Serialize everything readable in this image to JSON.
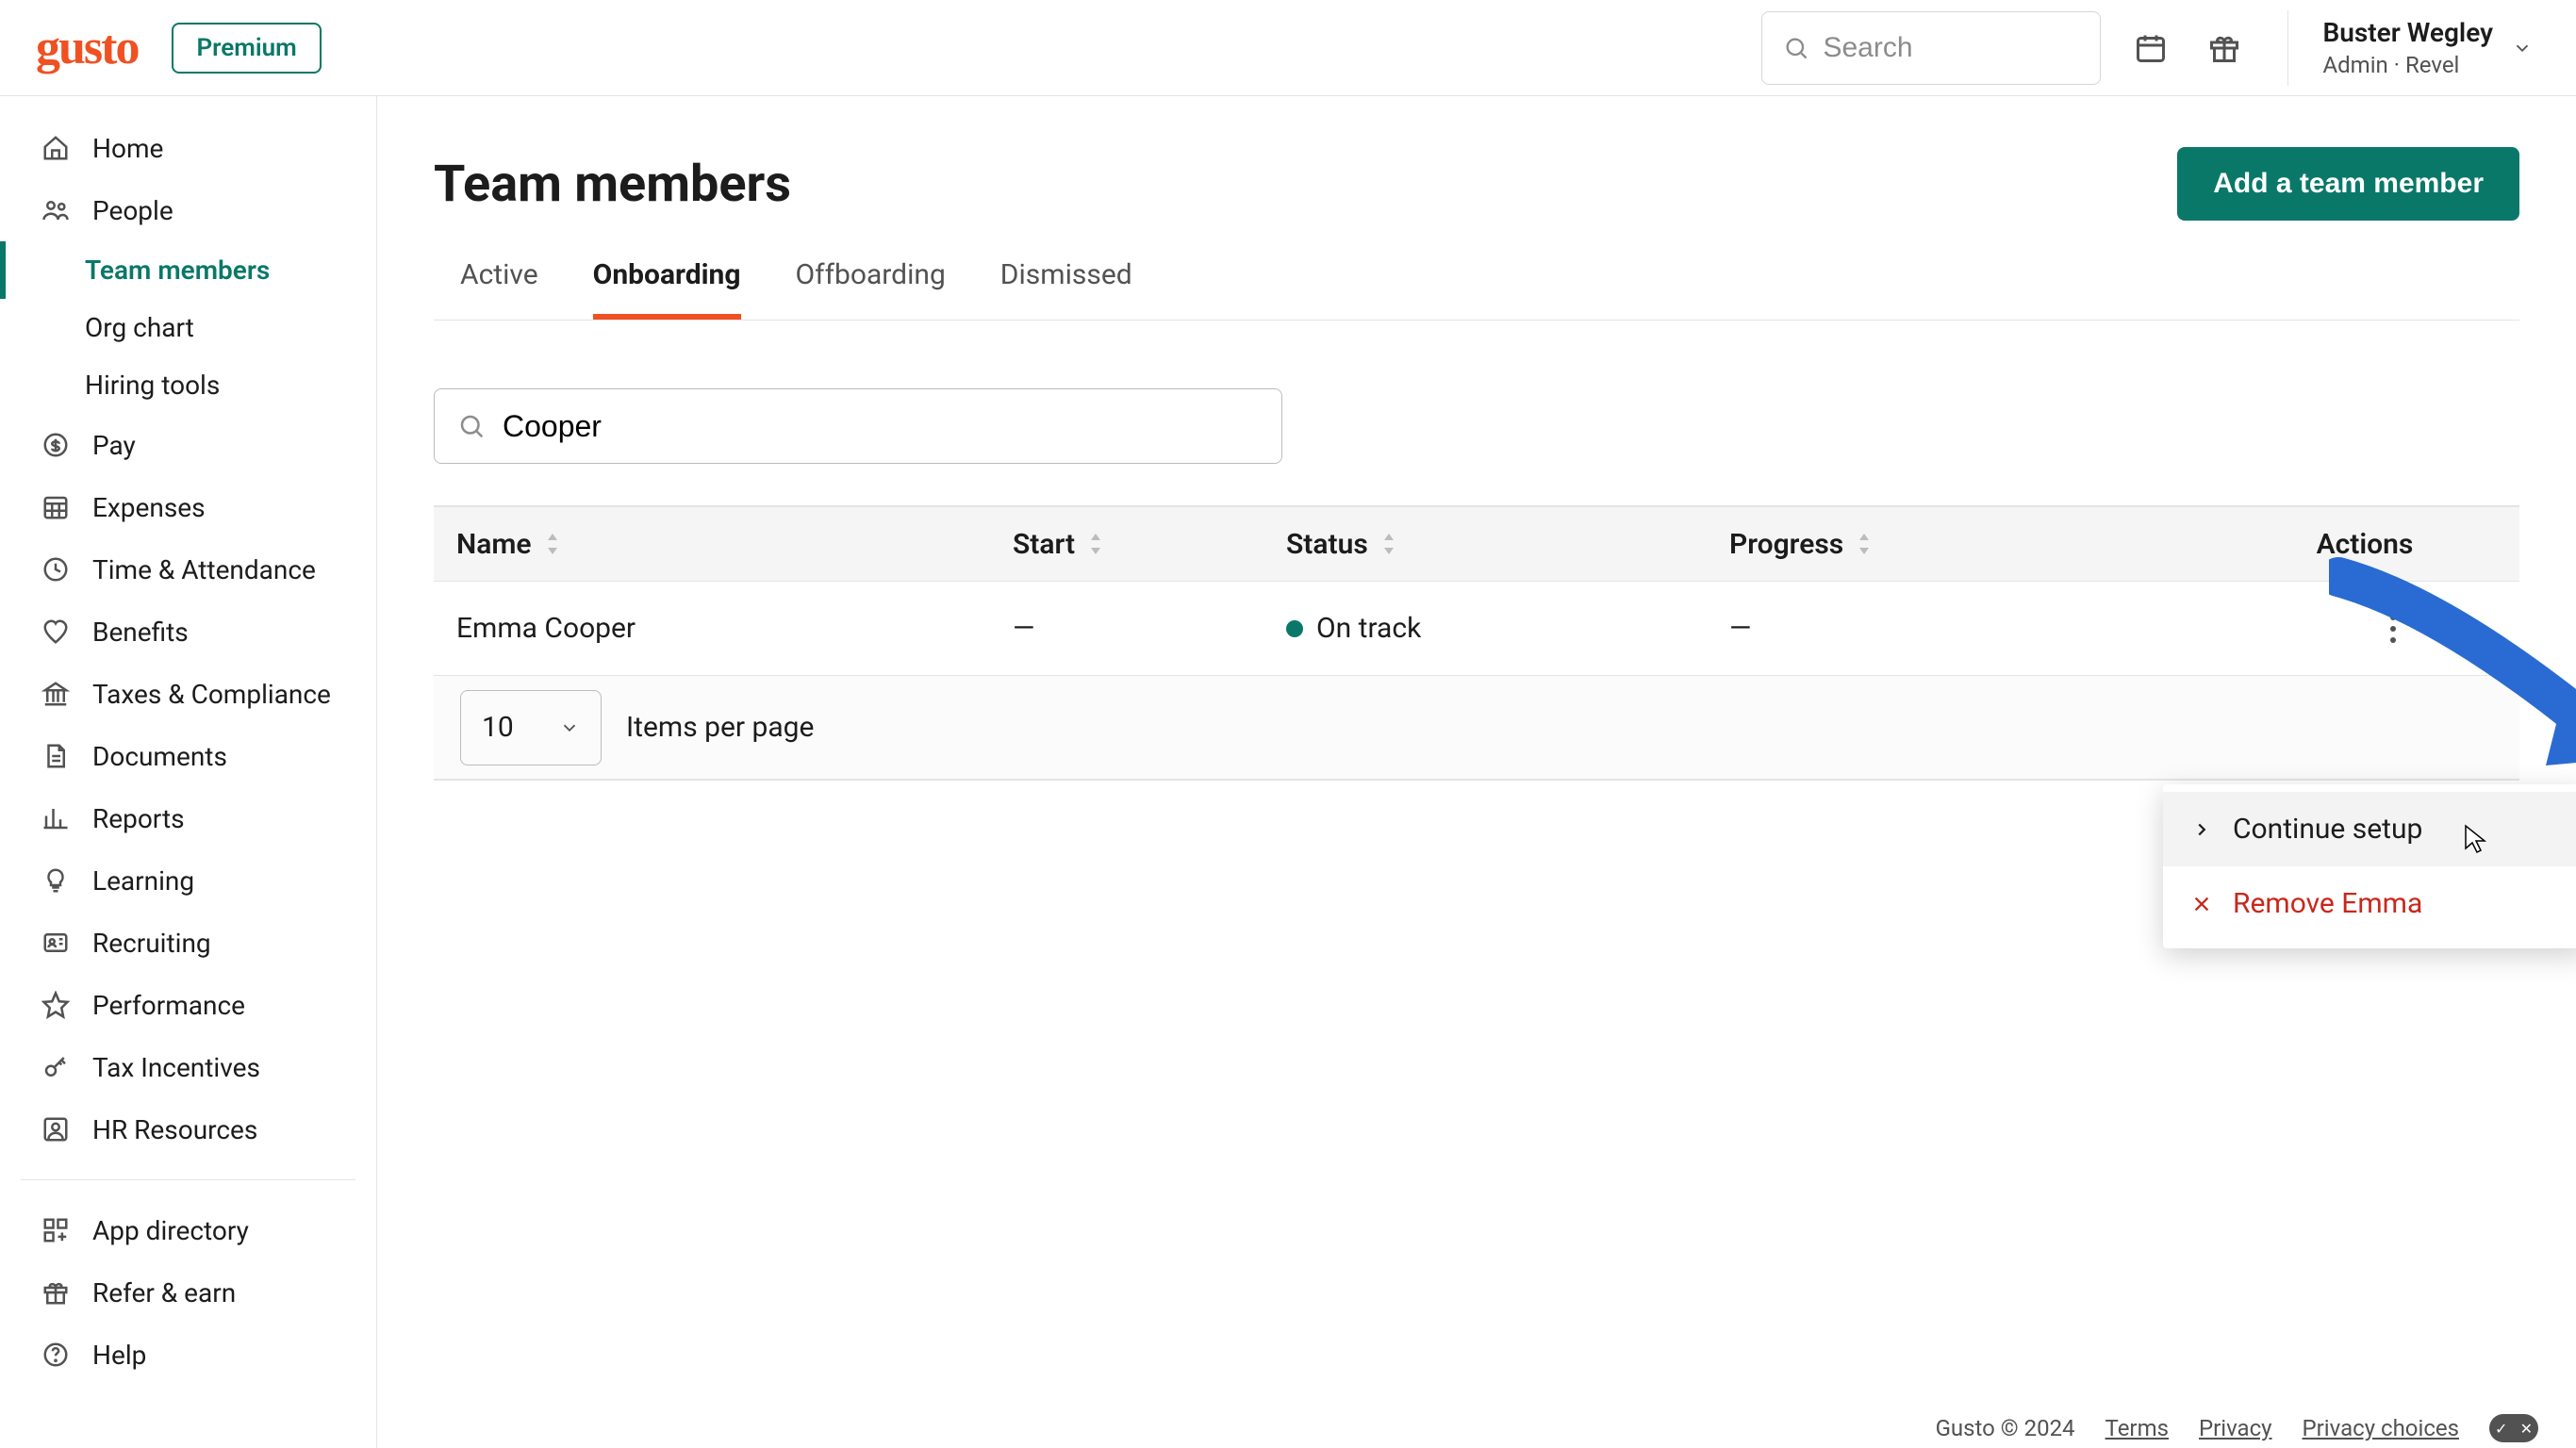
{
  "header": {
    "logo": "gusto",
    "premium_label": "Premium",
    "search_placeholder": "Search",
    "user_name": "Buster Wegley",
    "user_role": "Admin",
    "user_company": "Revel"
  },
  "sidebar": {
    "items": [
      {
        "label": "Home",
        "icon": "home-icon"
      },
      {
        "label": "People",
        "icon": "people-icon"
      },
      {
        "label": "Pay",
        "icon": "dollar-circle-icon"
      },
      {
        "label": "Expenses",
        "icon": "calendar-grid-icon"
      },
      {
        "label": "Time & Attendance",
        "icon": "clock-icon"
      },
      {
        "label": "Benefits",
        "icon": "heart-icon"
      },
      {
        "label": "Taxes & Compliance",
        "icon": "bank-icon"
      },
      {
        "label": "Documents",
        "icon": "doc-icon"
      },
      {
        "label": "Reports",
        "icon": "chart-icon"
      },
      {
        "label": "Learning",
        "icon": "lightbulb-icon"
      },
      {
        "label": "Recruiting",
        "icon": "id-icon"
      },
      {
        "label": "Performance",
        "icon": "star-icon"
      },
      {
        "label": "Tax Incentives",
        "icon": "key-icon"
      },
      {
        "label": "HR Resources",
        "icon": "user-square-icon"
      }
    ],
    "people_sub": [
      {
        "label": "Team members",
        "active": true
      },
      {
        "label": "Org chart",
        "active": false
      },
      {
        "label": "Hiring tools",
        "active": false
      }
    ],
    "secondary": [
      {
        "label": "App directory",
        "icon": "grid-plus-icon"
      },
      {
        "label": "Refer & earn",
        "icon": "gift-icon"
      },
      {
        "label": "Help",
        "icon": "help-icon"
      }
    ]
  },
  "page": {
    "title": "Team members",
    "add_button": "Add a team member",
    "tabs": [
      "Active",
      "Onboarding",
      "Offboarding",
      "Dismissed"
    ],
    "active_tab": "Onboarding",
    "search_value": "Cooper",
    "columns": {
      "name": "Name",
      "start": "Start",
      "status": "Status",
      "progress": "Progress",
      "actions": "Actions"
    },
    "rows": [
      {
        "name": "Emma Cooper",
        "start": "—",
        "status": "On track",
        "status_color": "#0a7868",
        "progress": "—"
      }
    ],
    "per_page_value": "10",
    "per_page_label": "Items per page"
  },
  "dropdown": {
    "continue": "Continue setup",
    "remove": "Remove Emma"
  },
  "footer": {
    "copyright": "Gusto © 2024",
    "links": [
      "Terms",
      "Privacy",
      "Privacy choices"
    ]
  }
}
